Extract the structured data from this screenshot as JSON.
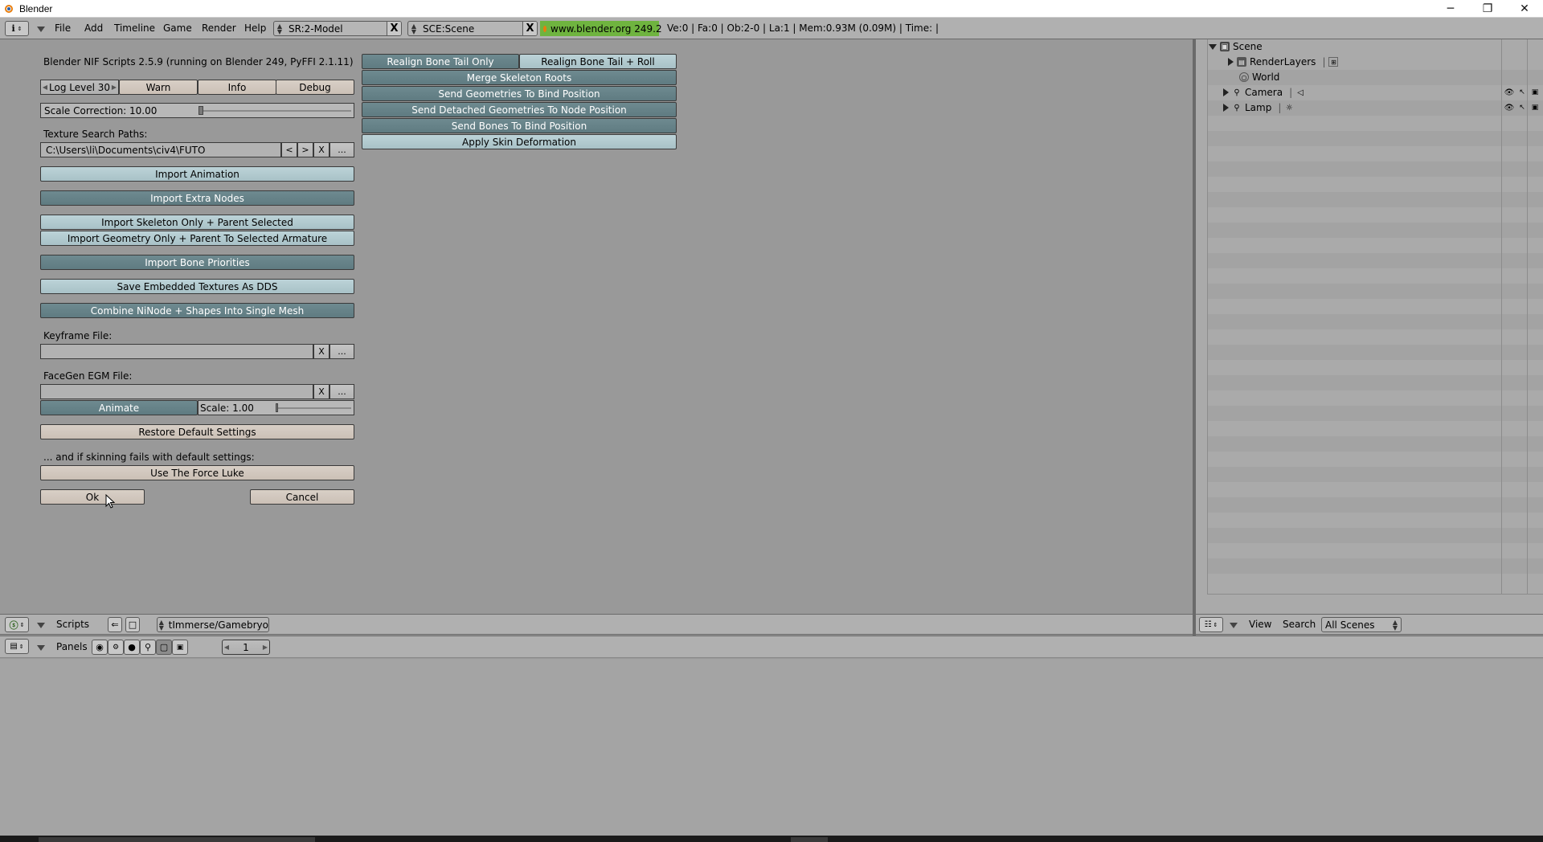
{
  "window": {
    "title": "Blender",
    "minimize": "─",
    "restore": "❐",
    "close": "✕"
  },
  "header": {
    "menus": [
      "File",
      "Add",
      "Timeline",
      "Game",
      "Render",
      "Help"
    ],
    "screen_field": "SR:2-Model",
    "scene_field": "SCE:Scene",
    "x_label": "X",
    "url": "www.blender.org 249.2",
    "stats": "Ve:0 | Fa:0 | Ob:2-0 | La:1  | Mem:0.93M (0.09M)  | Time: |"
  },
  "nif": {
    "title": "Blender NIF Scripts 2.5.9 (running on Blender 249, PyFFI 2.1.11)",
    "log_level": "Log Level 30",
    "warn": "Warn",
    "info": "Info",
    "debug": "Debug",
    "scale_correction": "Scale Correction:  10.00",
    "scale_correction_fraction": 0.5,
    "texture_paths_label": "Texture Search Paths:",
    "texture_path_value": "C:\\Users\\li\\Documents\\civ4\\FUTO",
    "prev": "<",
    "next": ">",
    "clear": "X",
    "browse": "...",
    "import_animation": "Import Animation",
    "import_extra_nodes": "Import Extra Nodes",
    "import_skeleton_only": "Import Skeleton Only + Parent Selected",
    "import_geometry_only": "Import Geometry Only + Parent To Selected Armature",
    "import_bone_priorities": "Import Bone Priorities",
    "save_embedded_textures": "Save Embedded Textures As DDS",
    "combine_ninode": "Combine NiNode + Shapes Into Single Mesh",
    "keyframe_label": "Keyframe File:",
    "keyframe_value": "",
    "facegen_label": "FaceGen EGM File:",
    "facegen_value": "",
    "animate": "Animate",
    "egm_scale": "Scale:  1.00",
    "egm_scale_fraction": 0.5,
    "restore_defaults": "Restore Default Settings",
    "skinning_note": "... and if skinning fails with default settings:",
    "force_luke": "Use The Force Luke",
    "ok": "Ok",
    "cancel": "Cancel",
    "realign_tail_only": "Realign Bone Tail Only",
    "realign_tail_roll": "Realign Bone Tail + Roll",
    "merge_skeleton_roots": "Merge Skeleton Roots",
    "send_geometries_bind": "Send Geometries To Bind Position",
    "send_detached_geometries": "Send Detached Geometries To Node Position",
    "send_bones_bind": "Send Bones To Bind Position",
    "apply_skin_deformation": "Apply Skin Deformation"
  },
  "scripts_header": {
    "label": "Scripts",
    "script_name": "tImmerse/Gamebryo"
  },
  "panels_header": {
    "label": "Panels",
    "frame": "1"
  },
  "outliner": {
    "items": [
      "Scene",
      "RenderLayers",
      "World",
      "Camera",
      "Lamp"
    ],
    "view": "View",
    "search": "Search",
    "scenes": "All Scenes"
  }
}
